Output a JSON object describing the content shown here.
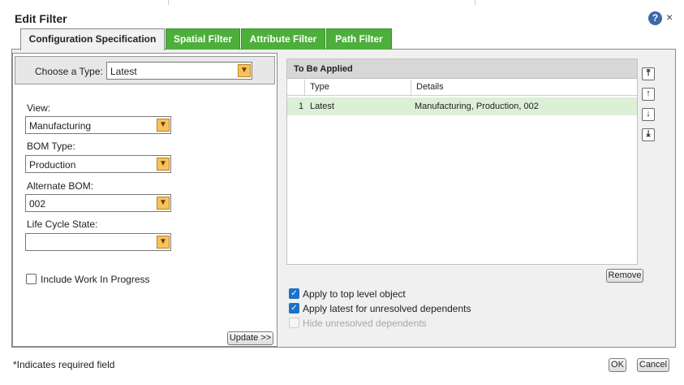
{
  "dialog": {
    "title": "Edit Filter"
  },
  "tabs": [
    {
      "label": "Configuration Specification"
    },
    {
      "label": "Spatial Filter"
    },
    {
      "label": "Attribute Filter"
    },
    {
      "label": "Path Filter"
    }
  ],
  "config": {
    "choose_type_label": "Choose a Type:",
    "choose_type_value": "Latest",
    "view_label": "View:",
    "view_value": "Manufacturing",
    "bom_type_label": "BOM Type:",
    "bom_type_value": "Production",
    "alternate_bom_label": "Alternate BOM:",
    "alternate_bom_value": "002",
    "life_cycle_label": "Life Cycle State:",
    "life_cycle_value": "",
    "include_wip_label": "Include Work In Progress",
    "update_button": "Update >>"
  },
  "to_be_applied": {
    "header": "To Be Applied",
    "columns": [
      "Type",
      "Details"
    ],
    "rows": [
      {
        "index": "1",
        "type": "Latest",
        "details": "Manufacturing, Production, 002"
      }
    ],
    "remove_button": "Remove"
  },
  "options": {
    "apply_top_level": {
      "label": "Apply to top level object",
      "checked": true
    },
    "apply_latest": {
      "label": "Apply latest for unresolved dependents",
      "checked": true
    },
    "hide_unresolved": {
      "label": "Hide unresolved dependents",
      "checked": false,
      "disabled": true
    }
  },
  "footer": {
    "required_note": "*Indicates required field",
    "ok_button": "OK",
    "cancel_button": "Cancel"
  },
  "icons": {
    "help": "help-icon",
    "close": "close-icon",
    "dropdown": "chevron-down-icon",
    "move_top": "move-to-top-icon",
    "move_up": "move-up-icon",
    "move_down": "move-down-icon",
    "move_bottom": "move-to-bottom-icon"
  },
  "colors": {
    "tab_green": "#4caf3a",
    "row_selected": "#dcefd7",
    "dropdown_arrow": "#f7c25a"
  }
}
